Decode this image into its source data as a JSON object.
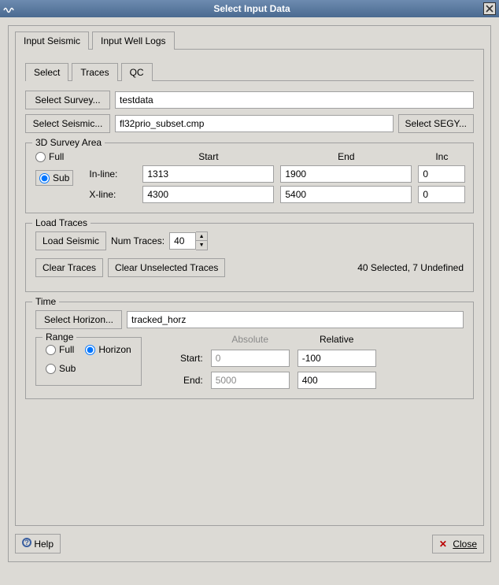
{
  "window": {
    "title": "Select Input Data"
  },
  "outerTabs": {
    "seismic": "Input Seismic",
    "wellLogs": "Input Well Logs"
  },
  "innerTabs": {
    "select": "Select",
    "traces": "Traces",
    "qc": "QC"
  },
  "survey": {
    "selectSurveyBtn": "Select Survey...",
    "surveyValue": "testdata",
    "selectSeismicBtn": "Select Seismic...",
    "seismicValue": "fl32prio_subset.cmp",
    "selectSegyBtn": "Select SEGY..."
  },
  "area": {
    "legend": "3D Survey Area",
    "full": "Full",
    "sub": "Sub",
    "startH": "Start",
    "endH": "End",
    "incH": "Inc",
    "inlineLabel": "In-line:",
    "xlineLabel": "X-line:",
    "inlineStart": "1313",
    "inlineEnd": "1900",
    "inlineInc": "0",
    "xlineStart": "4300",
    "xlineEnd": "5400",
    "xlineInc": "0"
  },
  "load": {
    "legend": "Load Traces",
    "loadBtn": "Load Seismic",
    "numLabel": "Num Traces:",
    "numValue": "40",
    "clearBtn": "Clear Traces",
    "clearUnselBtn": "Clear Unselected Traces",
    "status": "40 Selected, 7 Undefined"
  },
  "time": {
    "legend": "Time",
    "selectHorizonBtn": "Select Horizon...",
    "horizonValue": "tracked_horz",
    "rangeLegend": "Range",
    "full": "Full",
    "horizon": "Horizon",
    "sub": "Sub",
    "absH": "Absolute",
    "relH": "Relative",
    "startL": "Start:",
    "endL": "End:",
    "absStart": "0",
    "absEnd": "5000",
    "relStart": "-100",
    "relEnd": "400"
  },
  "bottom": {
    "help": "Help",
    "close": "Close"
  }
}
